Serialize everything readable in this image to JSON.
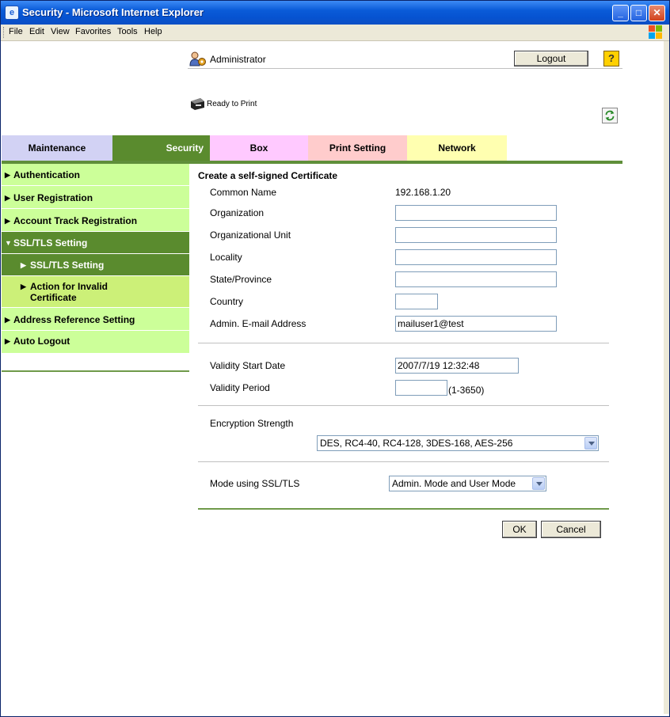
{
  "window": {
    "title": "Security - Microsoft Internet Explorer",
    "buttons": {
      "minimize": "_",
      "maximize": "□",
      "close": "✕"
    }
  },
  "menu": [
    "File",
    "Edit",
    "View",
    "Favorites",
    "Tools",
    "Help"
  ],
  "header": {
    "user": "Administrator",
    "logout": "Logout",
    "help": "?",
    "status": "Ready to Print"
  },
  "tabs": [
    {
      "label": "Maintenance",
      "color": "#d2d2f4"
    },
    {
      "label": "Security",
      "color": "#5a8b2e"
    },
    {
      "label": "Box",
      "color": "#ffc9ff"
    },
    {
      "label": "Print Setting",
      "color": "#ffcccc"
    },
    {
      "label": "Network",
      "color": "#ffffb0"
    }
  ],
  "sidebar": [
    {
      "label": "Authentication"
    },
    {
      "label": "User Registration"
    },
    {
      "label": "Account Track Registration"
    },
    {
      "label": "SSL/TLS Setting",
      "expanded": true
    },
    {
      "label": "SSL/TLS Setting",
      "selected": true
    },
    {
      "label": "Action for Invalid Certificate"
    },
    {
      "label": "Address Reference Setting"
    },
    {
      "label": "Auto Logout"
    }
  ],
  "form": {
    "title": "Create a self-signed Certificate",
    "common_name_label": "Common Name",
    "common_name_value": "192.168.1.20",
    "organization_label": "Organization",
    "organization_value": "",
    "org_unit_label": "Organizational Unit",
    "org_unit_value": "",
    "locality_label": "Locality",
    "locality_value": "",
    "state_label": "State/Province",
    "state_value": "",
    "country_label": "Country",
    "country_value": "",
    "email_label": "Admin. E-mail Address",
    "email_value": "mailuser1@test",
    "validity_start_label": "Validity Start Date",
    "validity_start_value": "2007/7/19 12:32:48",
    "validity_period_label": "Validity Period",
    "validity_period_value": "",
    "validity_period_hint": "(1-3650)",
    "encryption_label": "Encryption Strength",
    "encryption_value": "DES, RC4-40, RC4-128, 3DES-168, AES-256",
    "mode_label": "Mode using SSL/TLS",
    "mode_value": "Admin. Mode and User Mode",
    "ok": "OK",
    "cancel": "Cancel"
  },
  "colors": {
    "sidebar_light": "#ccff99",
    "sidebar_dark": "#5a8b2e",
    "sidebar_sub": "#ccf078"
  }
}
